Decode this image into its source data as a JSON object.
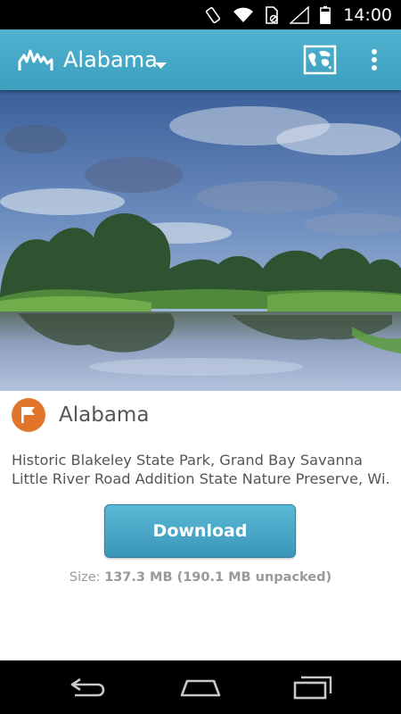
{
  "status_bar": {
    "time": "14:00",
    "icons": [
      "screen-rotation-icon",
      "wifi-icon",
      "sim-icon",
      "cell-signal-icon",
      "battery-icon"
    ]
  },
  "app_bar": {
    "title": "Alabama",
    "logo_icon": "app-logo-icon",
    "map_icon": "map-icon",
    "more_icon": "more-vert-icon",
    "color": "#42a6c4"
  },
  "region": {
    "name": "Alabama",
    "icon": "flag-icon",
    "icon_color": "#e1752a",
    "description": "Historic Blakeley State Park, Grand Bay Savanna Little River Road Addition State Nature Preserve, Wi."
  },
  "download": {
    "label": "Download",
    "size_label": "Size:",
    "size_value": "137.3 MB (190.1 MB unpacked)"
  },
  "nav_bar": {
    "icons": [
      "back-icon",
      "home-icon",
      "recents-icon"
    ]
  }
}
